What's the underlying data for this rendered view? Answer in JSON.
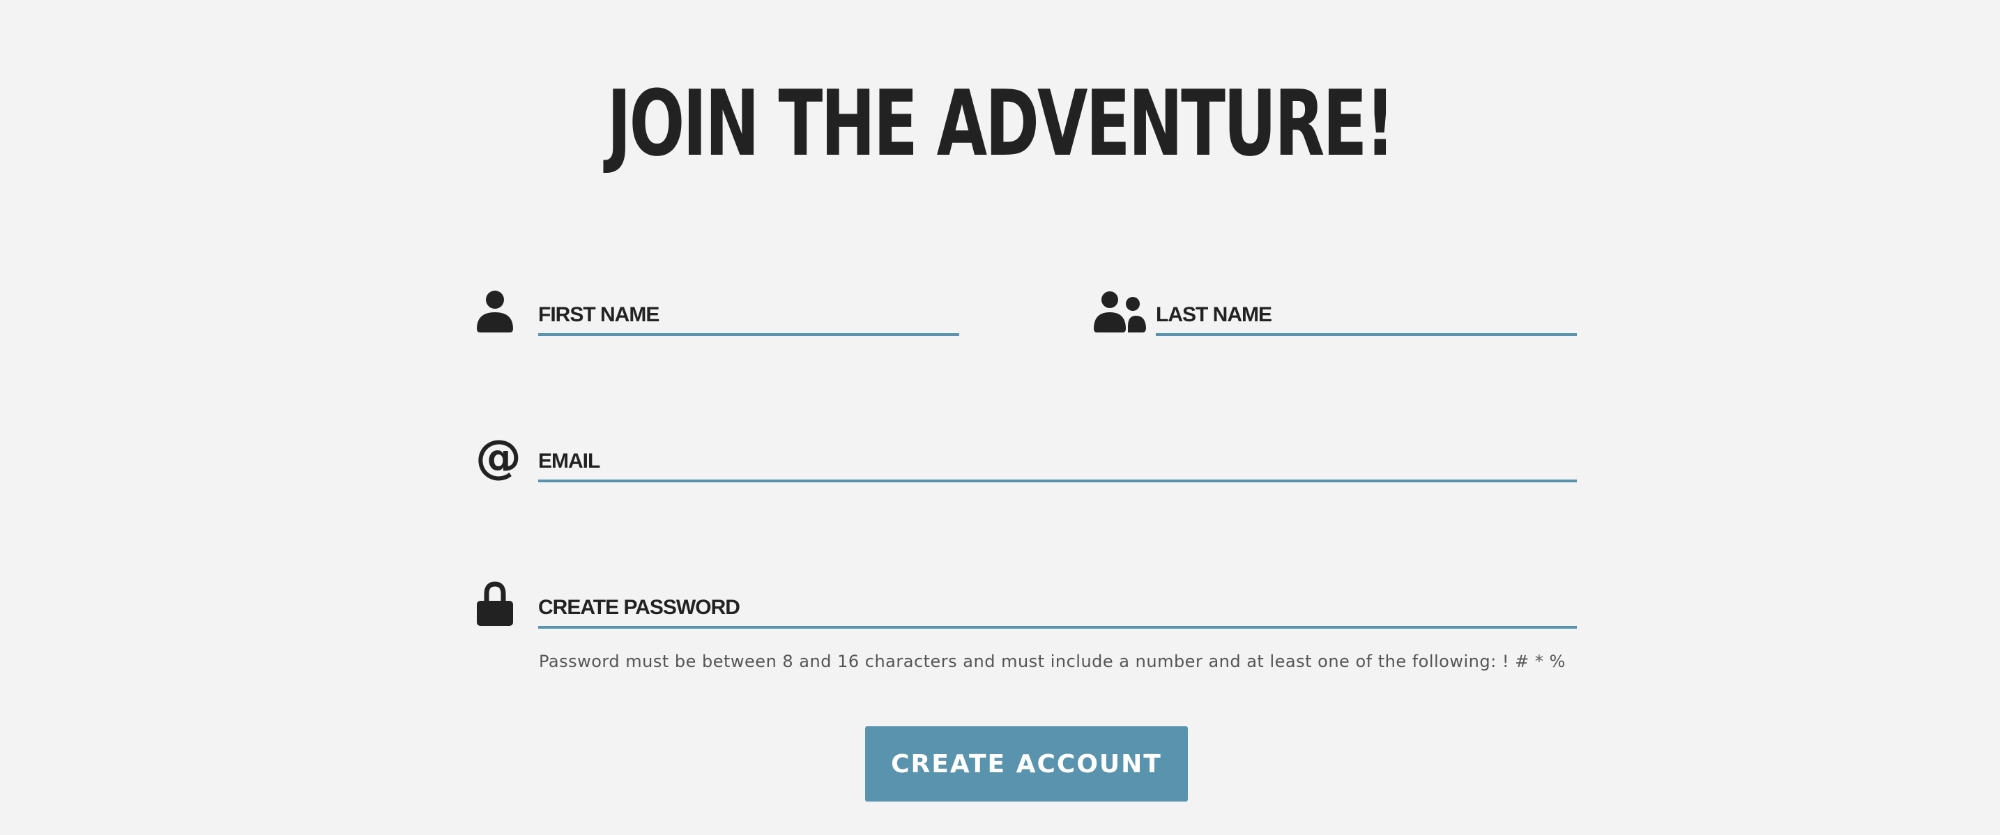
{
  "title": "JOIN THE ADVENTURE!",
  "form": {
    "first_name": {
      "placeholder": "FIRST NAME",
      "value": "",
      "icon": "user-icon"
    },
    "last_name": {
      "placeholder": "LAST NAME",
      "value": "",
      "icon": "users-icon"
    },
    "email": {
      "placeholder": "EMAIL",
      "value": "",
      "icon": "at-sign-icon"
    },
    "password": {
      "placeholder": "CREATE PASSWORD",
      "value": "",
      "icon": "lock-icon"
    },
    "password_hint": "Password must be between 8 and 16 characters and must include a number and at least one of the following: ! # * %",
    "submit_label": "CREATE ACCOUNT"
  },
  "colors": {
    "background": "#f3f3f3",
    "text": "#222222",
    "accent": "#5a93ad",
    "hint": "#555555",
    "button_text": "#ffffff"
  }
}
